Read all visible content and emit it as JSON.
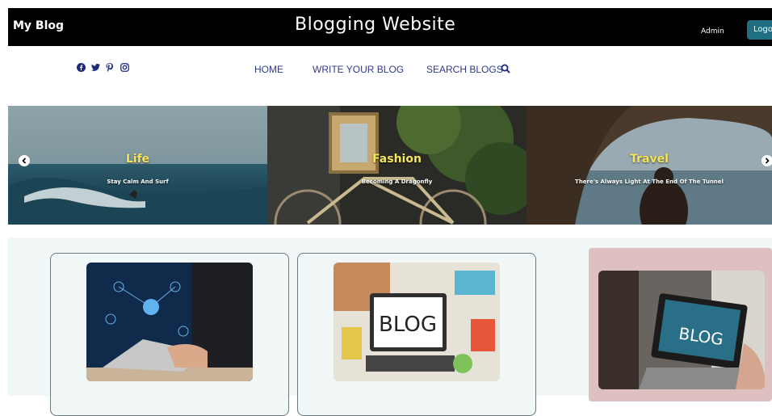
{
  "header": {
    "brand": "My Blog",
    "title": "Blogging Website",
    "user": "Admin",
    "logout_label": "Logout"
  },
  "social": [
    "facebook-icon",
    "twitter-icon",
    "pinterest-icon",
    "instagram-icon"
  ],
  "nav": {
    "home": "HOME",
    "write": "WRITE YOUR BLOG",
    "search": "SEARCH BLOGS"
  },
  "carousel": {
    "slides": [
      {
        "title": "Life",
        "subtitle": "Stay Calm And Surf"
      },
      {
        "title": "Fashion",
        "subtitle": "Becoming A Dragonfly"
      },
      {
        "title": "Travel",
        "subtitle": "There's Always Light At The End Of The Tunnel"
      }
    ]
  },
  "cards": {
    "card1_image": "laptop-cloud-image",
    "card2_image_text": "BLOG",
    "card3_image_text": "BLOG"
  },
  "colors": {
    "topbar": "#000000",
    "logout": "#1f6f82",
    "nav_text": "#2e3a8c",
    "caption_title": "#f4e55a",
    "cards_bg": "#f1f6f6",
    "pink_card": "#dfc0c0"
  }
}
